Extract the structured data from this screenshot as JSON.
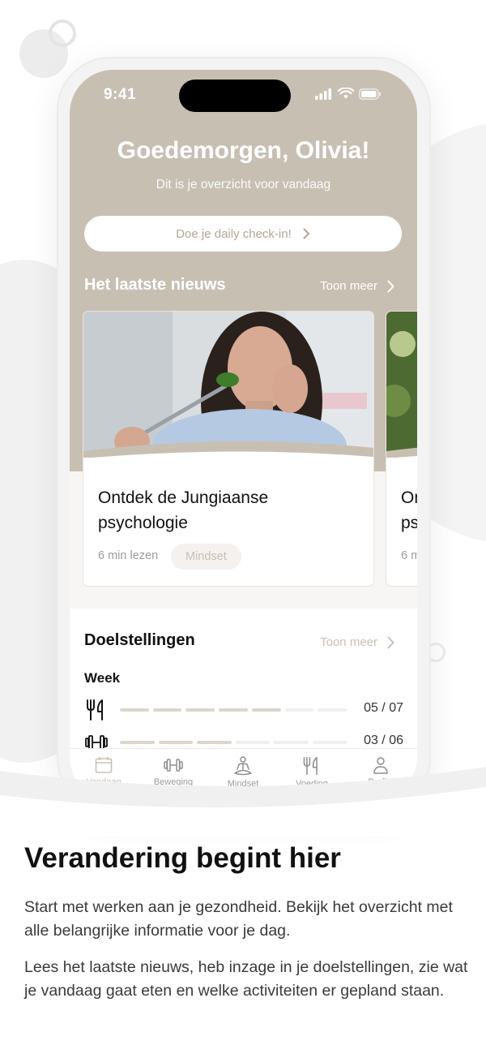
{
  "status_bar": {
    "time": "9:41"
  },
  "header": {
    "greeting": "Goedemorgen, Olivia!",
    "subtitle": "Dit is je overzicht voor vandaag",
    "checkin_label": "Doe je daily check-in!"
  },
  "news": {
    "title": "Het laatste nieuws",
    "more_label": "Toon meer",
    "cards": [
      {
        "title": "Ontdek de Jungiaanse psychologie",
        "meta": "6 min lezen",
        "tag": "Mindset"
      },
      {
        "title": "On ps",
        "meta": "6 m"
      }
    ]
  },
  "goals": {
    "title": "Doelstellingen",
    "more_label": "Toon meer",
    "period": "Week",
    "items": [
      {
        "icon": "fork-knife-icon",
        "value": "05 / 07",
        "done": 5,
        "total": 7
      },
      {
        "icon": "dumbbell-icon",
        "value": "03 / 06",
        "done": 3,
        "total": 6
      }
    ]
  },
  "tabs": [
    {
      "label": "Vandaag",
      "icon": "calendar-icon"
    },
    {
      "label": "Beweging",
      "icon": "dumbbell-icon"
    },
    {
      "label": "Mindset",
      "icon": "meditation-icon"
    },
    {
      "label": "Voeding",
      "icon": "fork-knife-icon"
    },
    {
      "label": "Profiel",
      "icon": "user-icon"
    }
  ],
  "promo": {
    "headline": "Verandering begint hier",
    "paragraph_1": "Start met werken aan je gezondheid. Bekijk het overzicht met alle belangrijke informatie voor je dag.",
    "paragraph_2": "Lees het laatste nieuws, heb inzage in je doelstellingen, zie wat je vandaag gaat eten en welke activiteiten er gepland staan."
  },
  "colors": {
    "hero": "#c8bfb3",
    "accent_muted": "#b1a698",
    "segment_filled": "#ddd6cc",
    "segment_empty": "#f1efed"
  }
}
